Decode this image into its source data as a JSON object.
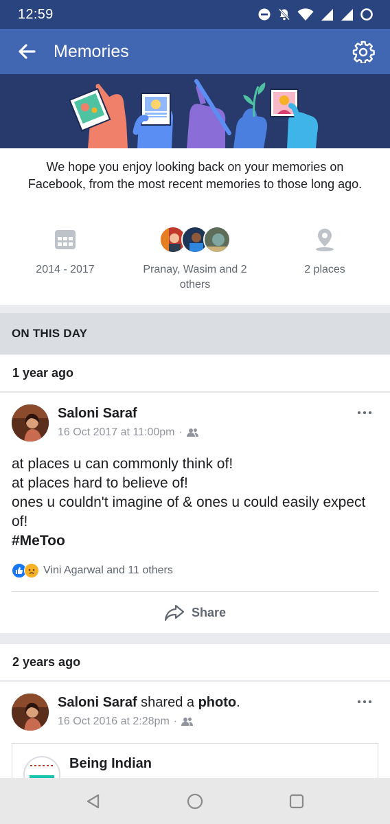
{
  "status_bar": {
    "time": "12:59"
  },
  "app_bar": {
    "title": "Memories"
  },
  "intro": {
    "text": "We hope you enjoy looking back on your memories on Facebook, from the most recent memories to those long ago.",
    "years": "2014 - 2017",
    "people": "Pranay, Wasim and 2 others",
    "places": "2 places"
  },
  "section": {
    "title": "ON THIS DAY"
  },
  "memories": [
    {
      "ago": "1 year ago",
      "author": "Saloni Saraf",
      "timestamp": "16 Oct 2017 at 11:00pm",
      "lines": [
        "at places u can commonly think of!",
        "at places hard to believe of!",
        "ones u couldn't imagine of & ones u could easily expect of!",
        "#MeToo"
      ],
      "reactions": "Vini Agarwal and 11 others",
      "share_label": "Share"
    },
    {
      "ago": "2 years ago",
      "author": "Saloni Saraf",
      "action_pre": "shared a",
      "action_obj": "photo",
      "action_post": ".",
      "timestamp": "16 Oct 2016 at 2:28pm",
      "shared_page": "Being Indian",
      "shared_page_logo": "BI"
    }
  ],
  "icons": {
    "back": "arrow-left-icon",
    "settings": "gear-icon",
    "calendar": "calendar-icon",
    "location": "location-pin-icon",
    "audience": "friends-icon",
    "more": "more-horizontal-icon",
    "share": "share-arrow-icon",
    "like": "like-reaction-icon",
    "sad": "sad-reaction-icon"
  },
  "colors": {
    "brand": "#4267b2",
    "status_bar": "#2a4480",
    "banner": "#28396b",
    "like": "#1877f2"
  }
}
